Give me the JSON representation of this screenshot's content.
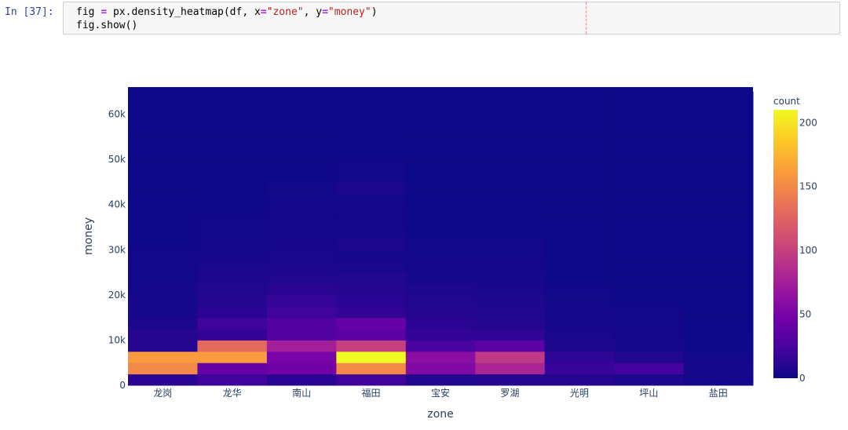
{
  "cell": {
    "prompt": "In [37]:",
    "code": {
      "line1": {
        "a": "fig ",
        "op1": "=",
        "b": " px.density_heatmap(df, x",
        "op2": "=",
        "s1": "\"zone\"",
        "c": ", y",
        "op3": "=",
        "s2": "\"money\"",
        "d": ")"
      },
      "line2": "fig.show()"
    }
  },
  "chart_data": {
    "type": "heatmap",
    "xlabel": "zone",
    "ylabel": "money",
    "categories": [
      "龙岗",
      "龙华",
      "南山",
      "福田",
      "宝安",
      "罗湖",
      "光明",
      "坪山",
      "盐田"
    ],
    "y_ticks": [
      {
        "value": 0,
        "label": "0"
      },
      {
        "value": 10000,
        "label": "10k"
      },
      {
        "value": 20000,
        "label": "20k"
      },
      {
        "value": 30000,
        "label": "30k"
      },
      {
        "value": 40000,
        "label": "40k"
      },
      {
        "value": 50000,
        "label": "50k"
      },
      {
        "value": 60000,
        "label": "60k"
      }
    ],
    "ylim": [
      0,
      66000
    ],
    "bin_size": 2500,
    "bin_counts": [
      [
        12,
        150,
        160,
        10,
        10,
        6,
        4,
        4,
        3,
        2,
        2,
        2,
        1,
        1,
        1,
        1,
        0,
        0,
        0,
        0,
        0,
        0,
        0,
        0,
        0,
        0
      ],
      [
        20,
        40,
        160,
        130,
        15,
        20,
        12,
        10,
        8,
        6,
        5,
        4,
        3,
        2,
        2,
        1,
        1,
        0,
        0,
        0,
        0,
        0,
        0,
        0,
        0,
        0
      ],
      [
        12,
        45,
        50,
        75,
        30,
        30,
        20,
        16,
        12,
        8,
        6,
        5,
        4,
        4,
        3,
        3,
        2,
        2,
        1,
        1,
        0,
        0,
        0,
        0,
        0,
        0
      ],
      [
        20,
        150,
        210,
        100,
        35,
        40,
        15,
        12,
        10,
        8,
        5,
        4,
        6,
        4,
        3,
        3,
        2,
        6,
        2,
        2,
        1,
        1,
        0,
        0,
        1,
        0
      ],
      [
        8,
        55,
        60,
        25,
        15,
        12,
        10,
        8,
        6,
        4,
        3,
        2,
        2,
        1,
        1,
        1,
        0,
        0,
        0,
        0,
        1,
        0,
        0,
        0,
        0,
        0
      ],
      [
        10,
        80,
        95,
        35,
        14,
        10,
        8,
        6,
        5,
        4,
        3,
        2,
        2,
        1,
        1,
        1,
        0,
        0,
        0,
        0,
        0,
        0,
        0,
        0,
        0,
        0
      ],
      [
        10,
        18,
        14,
        6,
        5,
        4,
        3,
        2,
        2,
        1,
        1,
        0,
        0,
        0,
        0,
        0,
        0,
        0,
        0,
        0,
        0,
        0,
        0,
        0,
        0,
        0
      ],
      [
        6,
        22,
        8,
        4,
        3,
        2,
        2,
        1,
        1,
        0,
        0,
        0,
        0,
        0,
        0,
        0,
        0,
        0,
        0,
        0,
        0,
        0,
        0,
        0,
        0,
        0
      ],
      [
        3,
        4,
        2,
        1,
        1,
        0,
        0,
        0,
        0,
        0,
        0,
        0,
        0,
        0,
        0,
        0,
        0,
        0,
        0,
        0,
        0,
        0,
        0,
        0,
        0,
        0
      ]
    ],
    "colorbar": {
      "title": "count",
      "range": [
        0,
        210
      ],
      "ticks": [
        {
          "value": 0,
          "label": "0"
        },
        {
          "value": 50,
          "label": "50"
        },
        {
          "value": 100,
          "label": "100"
        },
        {
          "value": 150,
          "label": "150"
        },
        {
          "value": 200,
          "label": "200"
        }
      ],
      "colorscale": [
        "#0d0887",
        "#46039f",
        "#7201a8",
        "#9c179e",
        "#bd3786",
        "#d8576b",
        "#ed7953",
        "#fb9f3a",
        "#fdca26",
        "#f0f921"
      ]
    },
    "grid": false,
    "legend": "right"
  }
}
